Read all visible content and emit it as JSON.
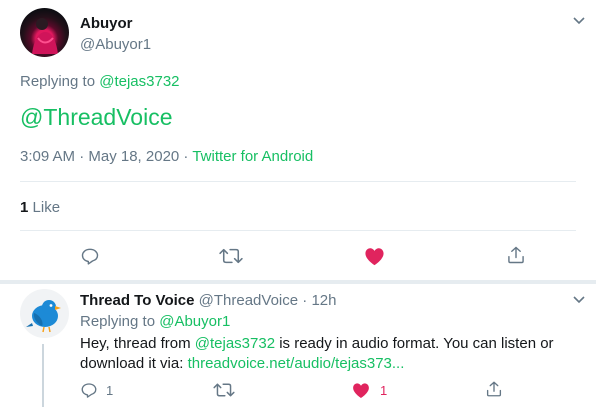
{
  "main_tweet": {
    "author_name": "Abuyor",
    "author_handle": "@Abuyor1",
    "replying_prefix": "Replying to",
    "replying_handle": "@tejas3732",
    "body": "@ThreadVoice",
    "timestamp": "3:09 AM · May 18, 2020 · ",
    "source": "Twitter for Android",
    "likes_count": "1",
    "likes_label": "Like",
    "liked": true
  },
  "reply_tweet": {
    "author_name": "Thread To Voice",
    "author_handle": "@ThreadVoice",
    "separator": " · ",
    "time": "12h",
    "replying_prefix": "Replying to",
    "replying_handle": "@Abuyor1",
    "text_before": "Hey, thread from ",
    "mention": "@tejas3732",
    "text_after": " is ready in audio format. You can listen or",
    "text_line2": "download it via: ",
    "link": "threadvoice.net/audio/tejas373...",
    "reply_count": "1",
    "like_count": "1",
    "liked": true
  },
  "colors": {
    "accent_green": "#17bf63",
    "like_red": "#e0245e",
    "muted": "#657786",
    "divider": "#e6ecf0"
  },
  "icons": [
    "chevron-down-icon",
    "reply-icon",
    "retweet-icon",
    "heart-icon",
    "share-icon",
    "bird-avatar-icon"
  ]
}
